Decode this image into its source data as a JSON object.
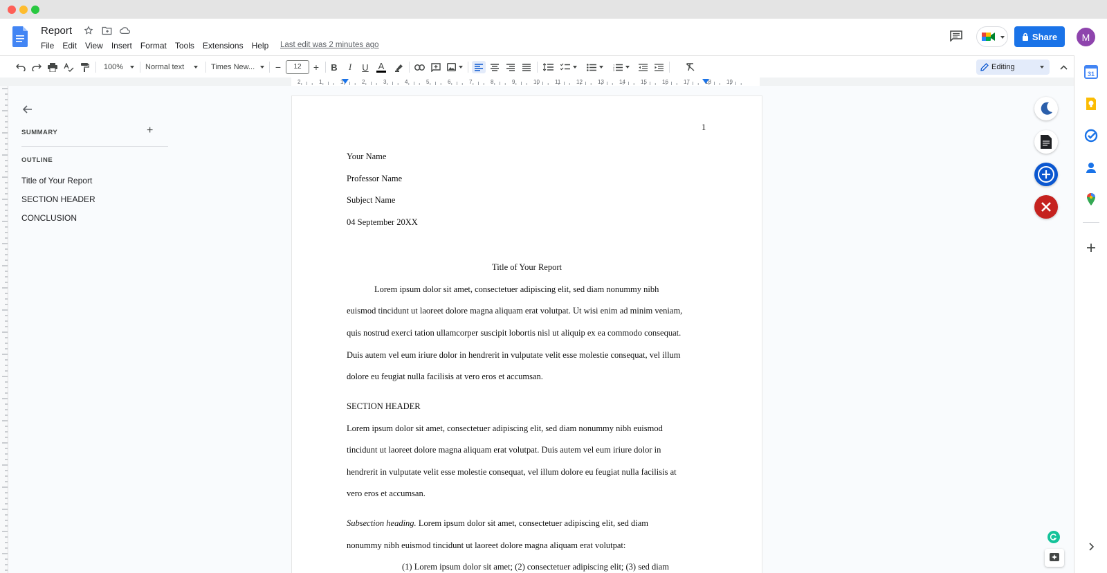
{
  "doc": {
    "title": "Report",
    "menu": [
      "File",
      "Edit",
      "View",
      "Insert",
      "Format",
      "Tools",
      "Extensions",
      "Help"
    ],
    "last_edit": "Last edit was 2 minutes ago"
  },
  "header": {
    "share_label": "Share",
    "avatar_letter": "M"
  },
  "toolbar": {
    "zoom": "100%",
    "style": "Normal text",
    "font": "Times New...",
    "font_size": "12",
    "mode": "Editing"
  },
  "ruler": {
    "marks": [
      "2",
      "1",
      "1",
      "2",
      "3",
      "4",
      "5",
      "6",
      "7",
      "8",
      "9",
      "10",
      "11",
      "12",
      "13",
      "14",
      "15",
      "16",
      "17",
      "18",
      "19"
    ]
  },
  "sidebar": {
    "summary_label": "SUMMARY",
    "outline_label": "OUTLINE",
    "outline_items": [
      "Title of Your Report",
      "SECTION HEADER",
      "CONCLUSION"
    ]
  },
  "page": {
    "page_number": "1",
    "author": "Your Name",
    "professor": "Professor Name",
    "subject": "Subject Name",
    "date": "04 September 20XX",
    "title": "Title of Your Report",
    "para1": [
      "Lorem ipsum dolor sit amet, consectetuer adipiscing elit, sed diam nonummy nibh",
      "euismod tincidunt ut laoreet dolore magna aliquam erat volutpat. Ut wisi enim ad minim veniam,",
      "quis nostrud exerci tation ullamcorper suscipit lobortis nisl ut aliquip ex ea commodo consequat.",
      "Duis autem vel eum iriure dolor in hendrerit in vulputate velit esse molestie consequat, vel illum",
      "dolore eu feugiat nulla facilisis at vero eros et accumsan."
    ],
    "section_header": "SECTION HEADER",
    "para2": [
      "Lorem ipsum dolor sit amet, consectetuer adipiscing elit, sed diam nonummy nibh euismod",
      "tincidunt ut laoreet dolore magna aliquam erat volutpat. Duis autem vel eum iriure dolor in",
      "hendrerit in vulputate velit esse molestie consequat, vel illum dolore eu feugiat nulla facilisis at",
      "vero eros et accumsan."
    ],
    "subsection_heading": "Subsection heading.",
    "para3_first": " Lorem ipsum dolor sit amet, consectetuer adipiscing elit, sed diam",
    "para3_second": "nonummy nibh euismod tincidunt ut laoreet dolore magna aliquam erat volutpat:",
    "list_line": "(1) Lorem ipsum dolor sit amet; (2) consectetuer adipiscing elit; (3) sed diam"
  },
  "colors": {
    "accent": "#1a73e8",
    "close_fab": "#c5221f",
    "add_fab": "#0b57d0"
  }
}
